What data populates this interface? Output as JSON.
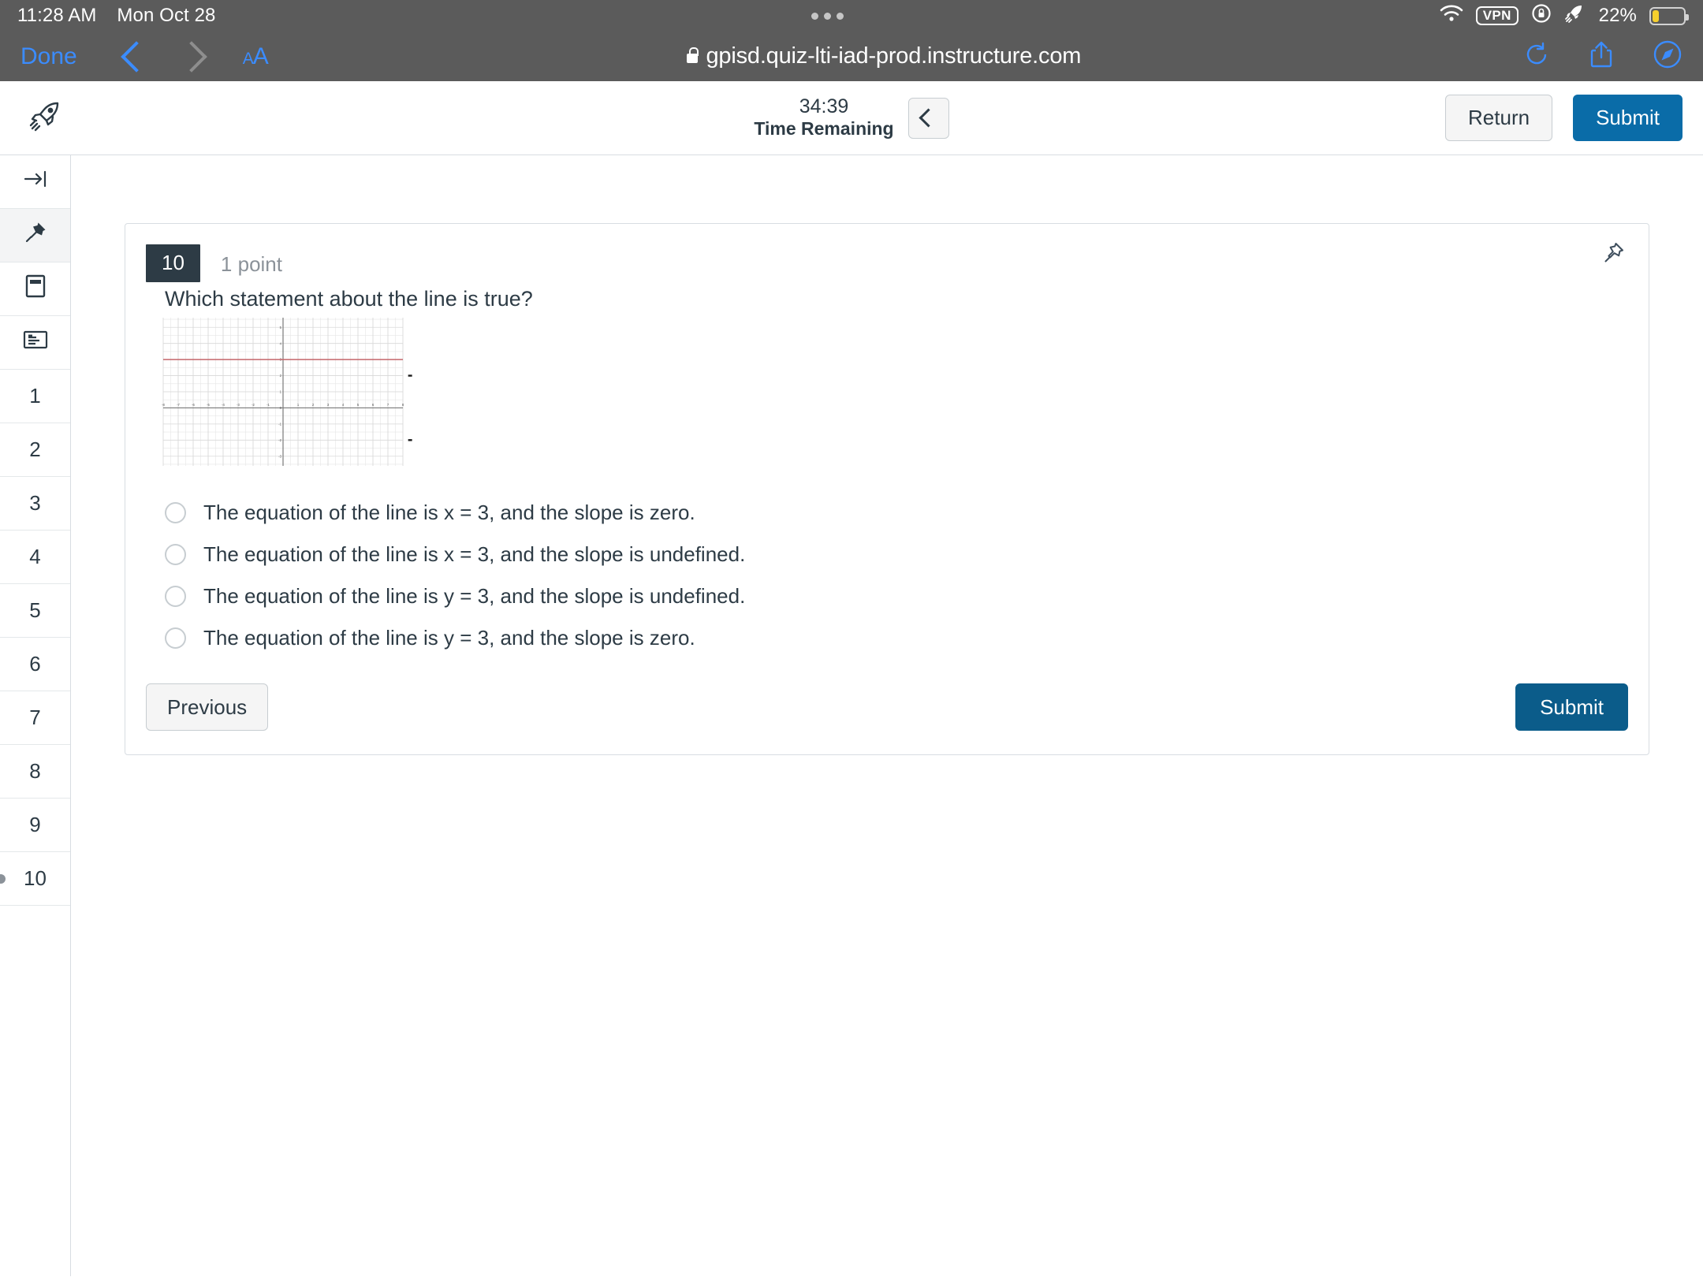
{
  "status_bar": {
    "time": "11:28 AM",
    "date": "Mon Oct 28",
    "wifi_icon": "wifi-icon",
    "vpn_label": "VPN",
    "rotation_lock_icon": "rotation-lock-icon",
    "rocket_icon": "rocket-icon",
    "battery_percent": "22%",
    "battery_fill_color": "#f6cf2e"
  },
  "browser": {
    "done_label": "Done",
    "back_icon": "chevron-left-icon",
    "forward_icon": "chevron-right-icon",
    "text_size_label": "A",
    "text_size_label_large": "A",
    "lock_icon": "lock-icon",
    "url": "gpisd.quiz-lti-iad-prod.instructure.com",
    "reload_icon": "reload-icon",
    "share_icon": "share-icon",
    "tabs_icon": "safari-compass-icon"
  },
  "quiz_header": {
    "app_icon": "rocket-icon",
    "timer_value": "34:39",
    "timer_label": "Time Remaining",
    "collapse_icon": "chevron-left-icon",
    "return_label": "Return",
    "submit_label": "Submit",
    "submit_color": "#0a6ca8"
  },
  "sidebar": {
    "tool_items": [
      {
        "icon": "collapse-panel-icon",
        "name": "collapse-panel"
      },
      {
        "icon": "pin-icon",
        "name": "pin-panel",
        "active": true
      },
      {
        "icon": "calculator-icon",
        "name": "calculator"
      },
      {
        "icon": "notes-icon",
        "name": "notes"
      }
    ],
    "question_items": [
      {
        "label": "1"
      },
      {
        "label": "2"
      },
      {
        "label": "3"
      },
      {
        "label": "4"
      },
      {
        "label": "5"
      },
      {
        "label": "6"
      },
      {
        "label": "7"
      },
      {
        "label": "8"
      },
      {
        "label": "9"
      },
      {
        "label": "10",
        "current": true
      }
    ]
  },
  "question": {
    "number": "10",
    "points": "1 point",
    "pin_icon": "pin-icon",
    "prompt": "Which statement about the line is true?",
    "options": [
      {
        "label": "The equation of the line is x = 3, and the slope is zero.",
        "selected": false
      },
      {
        "label": "The equation of the line is x = 3, and the slope is undefined.",
        "selected": false
      },
      {
        "label": "The equation of the line is y = 3, and the slope is undefined.",
        "selected": false
      },
      {
        "label": "The equation of the line is y = 3, and the slope is zero.",
        "selected": false
      }
    ],
    "previous_label": "Previous",
    "submit_label": "Submit",
    "submit_color": "#0b5c8a"
  },
  "chart_data": {
    "type": "line",
    "title": "",
    "xlabel": "",
    "ylabel": "",
    "xlim": [
      -8,
      8
    ],
    "ylim": [
      -3.6,
      5.6
    ],
    "xticks": [
      -8,
      -7,
      -6,
      -5,
      -4,
      -3,
      -2,
      -1,
      0,
      1,
      2,
      3,
      4,
      5,
      6,
      7,
      8
    ],
    "yticks": [
      -3,
      -2,
      -1,
      0,
      1,
      2,
      3,
      4,
      5
    ],
    "grid": true,
    "minor_grid": true,
    "minor_step": 0.5,
    "line_color": "#c4666a",
    "axis_color": "#7a7a7a",
    "grid_color": "#d9d9d9",
    "series": [
      {
        "name": "y = 3",
        "equation": "y = 3",
        "x": [
          -8,
          8
        ],
        "values": [
          3,
          3
        ]
      }
    ],
    "annotations": [
      {
        "type": "tick-mark",
        "x": 8.35,
        "y": 2
      },
      {
        "type": "tick-mark",
        "x": 8.35,
        "y": -2
      }
    ]
  }
}
